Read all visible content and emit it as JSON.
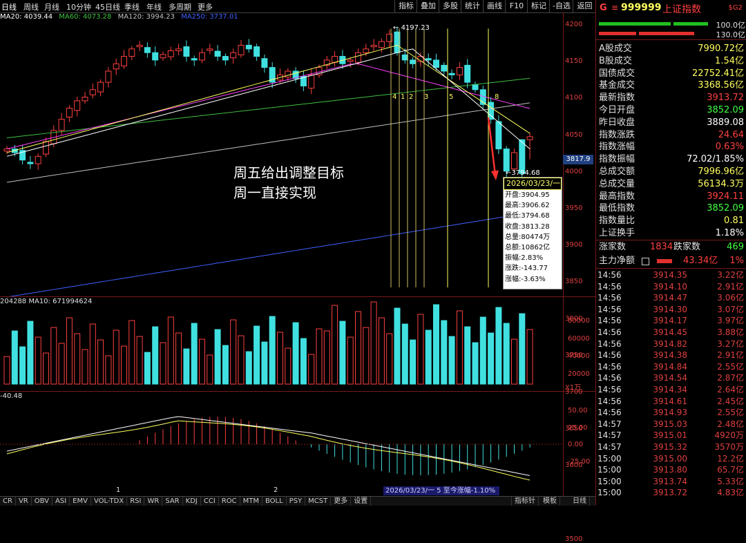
{
  "period_tabs": [
    "日线",
    "周线",
    "月线",
    "10分钟",
    "45日线",
    "季线",
    "年线",
    "多周期",
    "更多"
  ],
  "toolbar_buttons": [
    "指标",
    "叠加",
    "多股",
    "统计",
    "画线",
    "F10",
    "标记",
    "-自选",
    "返回"
  ],
  "ma_legend": [
    {
      "label": "MA20: 4039.44",
      "color": "#ffffff"
    },
    {
      "label": "MA60: 4073.28",
      "color": "#40c040"
    },
    {
      "label": "MA120: 3994.23",
      "color": "#c0c0c0"
    },
    {
      "label": "MA250: 3737.01",
      "color": "#4060ff"
    }
  ],
  "price_axis": [
    "4200",
    "4150",
    "4100",
    "4050",
    "4000",
    "3950",
    "3900",
    "3850",
    "3800",
    "3750",
    "3700",
    "3650",
    "3600",
    "3550",
    "3500"
  ],
  "current_price_tag": "3817.9",
  "high_marker": "4197.23",
  "low_marker": "3794.68",
  "wave_labels": [
    "4",
    "1",
    "2",
    "3",
    "5",
    "8",
    "1"
  ],
  "annotation": {
    "line1": "周五给出调整目标",
    "line2": "周一直接实现"
  },
  "tooltip": {
    "date": "2026/03/23/一",
    "lines": [
      "开盘:3904.95",
      "最高:3906.62",
      "最低:3794.68",
      "收盘:3813.28",
      "总量:80474万",
      "总额:10862亿",
      "振幅:2.83%",
      "涨跌:-143.77",
      "涨幅:-3.63%"
    ]
  },
  "volume_legend": "204288  MA10: 671994624",
  "volume_axis": [
    "80000",
    "60000",
    "40000",
    "20000"
  ],
  "volume_unit": "X1万",
  "macd_legend": "-40.48",
  "macd_axis": [
    "50.00",
    "25.00",
    "0.00",
    "-25.00"
  ],
  "time_axis_labels": [
    "1",
    "2"
  ],
  "period_label": "2026/03/23/一 5 至今涨幅-1.10%",
  "bottom_tabs": [
    "CR",
    "VR",
    "OBV",
    "ASI",
    "EMV",
    "VOL-TDX",
    "RSI",
    "WR",
    "SAR",
    "KDJ",
    "CCI",
    "ROC",
    "MTM",
    "BOLL",
    "PSY",
    "MCST",
    "更多",
    "设置"
  ],
  "bottom_right": [
    "指标针",
    "模板",
    "日线"
  ],
  "stock": {
    "code": "999999",
    "name": "上证指数",
    "tag": "$G2",
    "prefix": "G"
  },
  "ratios": [
    "100.0亿",
    "130.0亿"
  ],
  "stats": [
    {
      "label": "A股成交",
      "value": "7990.72亿",
      "color": "#ffff60"
    },
    {
      "label": "B股成交",
      "value": "1.54亿",
      "color": "#ffff60"
    },
    {
      "label": "国债成交",
      "value": "22752.41亿",
      "color": "#ffff60"
    },
    {
      "label": "基金成交",
      "value": "3368.56亿",
      "color": "#ffff60"
    },
    {
      "label": "最新指数",
      "value": "3913.72",
      "color": "#ff4040"
    },
    {
      "label": "今日开盘",
      "value": "3852.09",
      "color": "#40ff40"
    },
    {
      "label": "昨日收盘",
      "value": "3889.08",
      "color": "#ffffff"
    },
    {
      "label": "指数涨跌",
      "value": "24.64",
      "color": "#ff4040"
    },
    {
      "label": "指数涨幅",
      "value": "0.63%",
      "color": "#ff4040"
    },
    {
      "label": "指数振幅",
      "value": "72.02/1.85%",
      "color": "#ffffff"
    },
    {
      "label": "总成交额",
      "value": "7996.96亿",
      "color": "#ffff60"
    },
    {
      "label": "总成交量",
      "value": "56134.3万",
      "color": "#ffff60"
    },
    {
      "label": "最高指数",
      "value": "3924.11",
      "color": "#ff4040"
    },
    {
      "label": "最低指数",
      "value": "3852.09",
      "color": "#40ff40"
    },
    {
      "label": "指数量比",
      "value": "0.81",
      "color": "#ffff60"
    },
    {
      "label": "上证换手",
      "value": "1.18%",
      "color": "#ffffff"
    }
  ],
  "breadth": {
    "up_label": "涨家数",
    "up": "1834",
    "down_label": "跌家数",
    "down": "469"
  },
  "net_flow": {
    "label": "主力净额",
    "value": "43.34亿",
    "pct": "1%"
  },
  "ticks": [
    {
      "t": "14:56",
      "p": "3914.35",
      "v": "3.22亿"
    },
    {
      "t": "14:56",
      "p": "3914.10",
      "v": "2.91亿"
    },
    {
      "t": "14:56",
      "p": "3914.47",
      "v": "3.06亿"
    },
    {
      "t": "14:56",
      "p": "3914.30",
      "v": "3.07亿"
    },
    {
      "t": "14:56",
      "p": "3914.17",
      "v": "3.97亿"
    },
    {
      "t": "14:56",
      "p": "3914.45",
      "v": "3.88亿"
    },
    {
      "t": "14:56",
      "p": "3914.82",
      "v": "3.27亿"
    },
    {
      "t": "14:56",
      "p": "3914.38",
      "v": "2.91亿"
    },
    {
      "t": "14:56",
      "p": "3914.84",
      "v": "2.55亿"
    },
    {
      "t": "14:56",
      "p": "3914.54",
      "v": "2.87亿"
    },
    {
      "t": "14:56",
      "p": "3914.34",
      "v": "2.64亿"
    },
    {
      "t": "14:56",
      "p": "3914.61",
      "v": "2.45亿"
    },
    {
      "t": "14:56",
      "p": "3914.93",
      "v": "2.55亿"
    },
    {
      "t": "14:57",
      "p": "3915.03",
      "v": "2.48亿"
    },
    {
      "t": "14:57",
      "p": "3915.01",
      "v": "4920万"
    },
    {
      "t": "14:57",
      "p": "3915.32",
      "v": "3570万"
    },
    {
      "t": "15:00",
      "p": "3915.00",
      "v": "12.2亿"
    },
    {
      "t": "15:00",
      "p": "3913.80",
      "v": "65.7亿"
    },
    {
      "t": "15:00",
      "p": "3913.74",
      "v": "5.33亿"
    },
    {
      "t": "15:00",
      "p": "3913.72",
      "v": "4.83亿"
    }
  ],
  "chart_data": {
    "type": "candlestick",
    "last_candle": {
      "date": "2026/03/23",
      "open": 3904.95,
      "high": 3906.62,
      "low": 3794.68,
      "close": 3813.28
    },
    "period_high": 4197.23,
    "period_low": 3794.68,
    "ylim": [
      3480,
      4215
    ]
  }
}
